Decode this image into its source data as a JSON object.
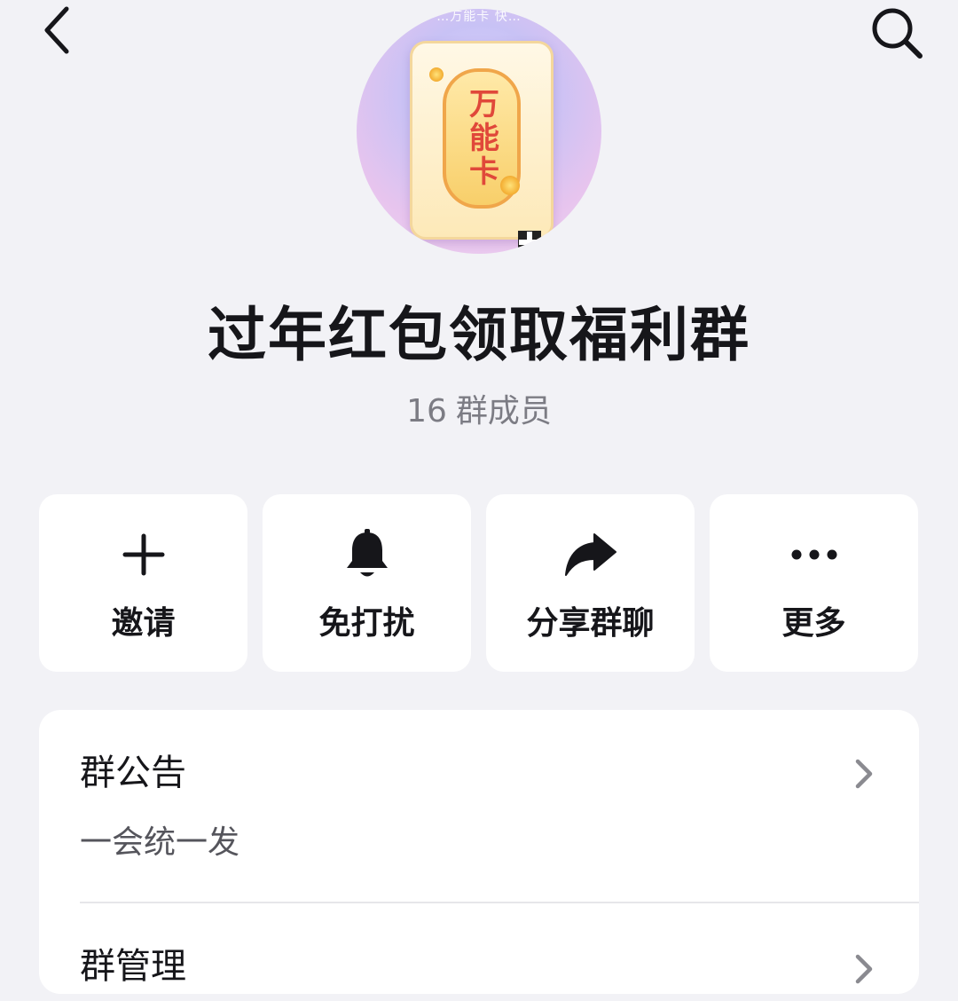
{
  "nav": {
    "back_icon": "chevron-left-icon",
    "search_icon": "search-icon"
  },
  "avatar": {
    "top_text": "…万能卡 快…",
    "card_text": "万能卡",
    "qr_icon": "qr-code-icon"
  },
  "group": {
    "name": "过年红包领取福利群",
    "member_count": "16",
    "member_label": "群成员"
  },
  "actions": [
    {
      "label": "邀请",
      "icon": "plus-icon"
    },
    {
      "label": "免打扰",
      "icon": "bell-icon"
    },
    {
      "label": "分享群聊",
      "icon": "share-arrow-icon"
    },
    {
      "label": "更多",
      "icon": "more-dots-icon"
    }
  ],
  "list": {
    "announcement": {
      "title": "群公告",
      "content": "一会统一发"
    },
    "management": {
      "title": "群管理"
    }
  },
  "colors": {
    "background": "#f2f2f6",
    "card": "#ffffff",
    "text_primary": "#16161a",
    "text_secondary": "#7c7c84",
    "chevron": "#8a8a90"
  }
}
